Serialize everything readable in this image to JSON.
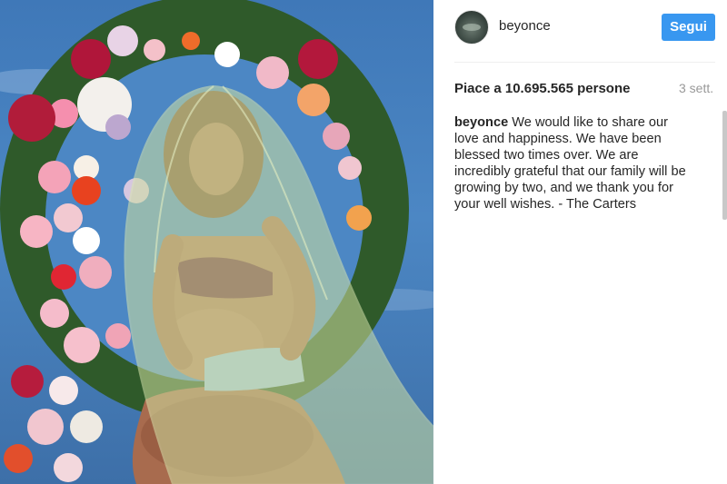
{
  "post": {
    "photo": {
      "subject": "Pregnant woman in lingerie wearing a sheer green veil, kneeling in front of a large floral wreath against a blue sky"
    },
    "header": {
      "username": "beyonce",
      "follow_label": "Segui"
    },
    "stats": {
      "likes_text": "Piace a 10.695.565 persone",
      "time_ago": "3 sett."
    },
    "caption": {
      "username": "beyonce",
      "text": "We would like to share our love and happiness. We have been blessed two times over. We are incredibly grateful that our family will be growing by two, and we thank you for your well wishes. - The Carters"
    }
  },
  "colors": {
    "follow_button": "#3897f0",
    "sky": "#4c87c4",
    "veil": "#cfe0a0"
  },
  "icons": {
    "avatar": "profile-avatar"
  }
}
